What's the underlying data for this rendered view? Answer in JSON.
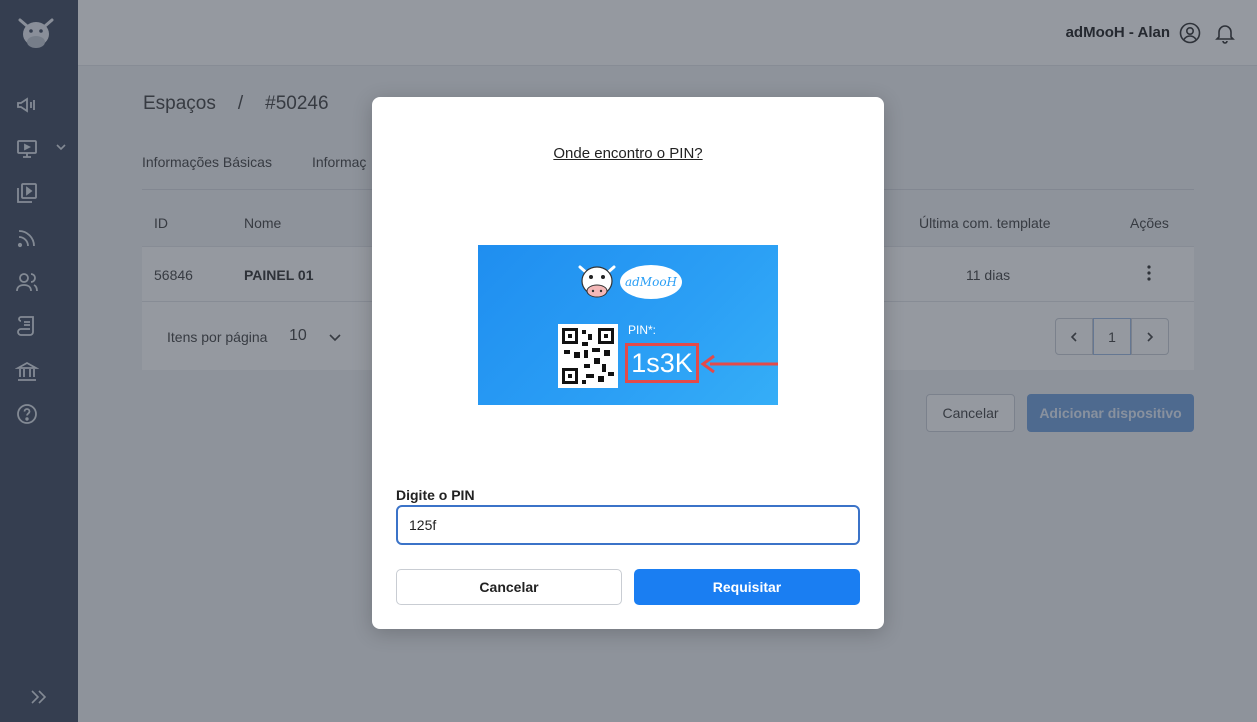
{
  "header": {
    "user_label": "adMooH - Alan"
  },
  "breadcrumb": {
    "section": "Espaços",
    "separator": "/",
    "item": "#50246"
  },
  "tabs": [
    "Informações Básicas",
    "Informaç"
  ],
  "table": {
    "columns": [
      "ID",
      "Nome",
      "Última com. template",
      "Ações"
    ],
    "rows": [
      {
        "id": "56846",
        "name": "PAINEL 01",
        "last_com": "11 dias",
        "actions_icon": "more-vertical-icon"
      }
    ],
    "pagination": {
      "per_page_label": "Itens por página",
      "per_page_value": "10",
      "current_page": "1"
    }
  },
  "page_actions": {
    "cancel_label": "Cancelar",
    "add_label": "Adicionar dispositivo"
  },
  "modal": {
    "help_link": "Onde encontro o PIN?",
    "image": {
      "brand_text": "adMooH",
      "pin_label": "PIN*:",
      "pin_example": "1s3K"
    },
    "input_label": "Digite o PIN",
    "input_value": "125f",
    "cancel_label": "Cancelar",
    "submit_label": "Requisitar"
  },
  "colors": {
    "sidebar": "#515a6e",
    "primary": "#1a7ef2",
    "image_bg": "#2b9ff5",
    "highlight": "#e34a4a"
  }
}
